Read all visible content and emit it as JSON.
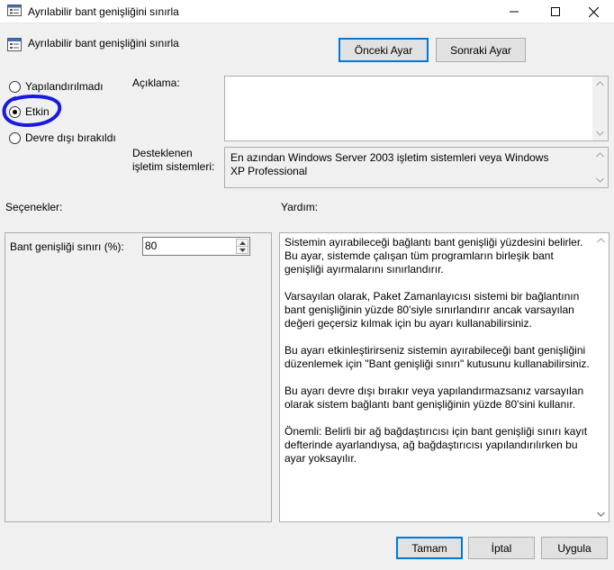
{
  "window": {
    "title": "Ayrılabilir bant genişliğini sınırla",
    "controls": [
      "minimize",
      "maximize",
      "close"
    ]
  },
  "header": {
    "policy_name": "Ayrılabilir bant genişliğini sınırla",
    "prev_button": "Önceki Ayar",
    "next_button": "Sonraki Ayar"
  },
  "state_options": [
    {
      "label": "Yapılandırılmadı",
      "selected": false
    },
    {
      "label": "Etkin",
      "selected": true
    },
    {
      "label": "Devre dışı bırakıldı",
      "selected": false
    }
  ],
  "comment": {
    "label": "Açıklama:",
    "value": ""
  },
  "supported": {
    "label_line1": "Desteklenen",
    "label_line2": "işletim sistemleri:",
    "value": "En azından Windows Server 2003 işletim sistemleri veya Windows XP Professional"
  },
  "options": {
    "heading": "Seçenekler:",
    "bandwidth_label": "Bant genişliği sınırı (%):",
    "bandwidth_value": "80"
  },
  "help": {
    "heading": "Yardım:",
    "paragraphs": [
      "Sistemin ayırabileceği bağlantı bant genişliği yüzdesini belirler. Bu ayar, sistemde çalışan tüm programların birleşik bant genişliği ayırmalarını sınırlandırır.",
      "Varsayılan olarak, Paket Zamanlayıcısı sistemi bir bağlantının bant genişliğinin yüzde 80'siyle sınırlandırır ancak varsayılan değeri geçersiz kılmak için bu ayarı kullanabilirsiniz.",
      "Bu ayarı etkinleştirirseniz sistemin ayırabileceği bant genişliğini düzenlemek için \"Bant genişliği sınırı\" kutusunu kullanabilirsiniz.",
      "Bu ayarı devre dışı bırakır veya yapılandırmazsanız varsayılan olarak sistem bağlantı bant genişliğinin yüzde 80'sini kullanır.",
      "Önemli: Belirli bir ağ bağdaştırıcısı için bant genişliği sınırı kayıt defterinde ayarlandıysa, ağ bağdaştırıcısı yapılandırılırken bu ayar yoksayılır."
    ]
  },
  "footer": {
    "ok": "Tamam",
    "cancel": "İptal",
    "apply": "Uygula"
  },
  "colors": {
    "annotation_circle": "#1a1adb",
    "primary_border": "#0078d7"
  }
}
